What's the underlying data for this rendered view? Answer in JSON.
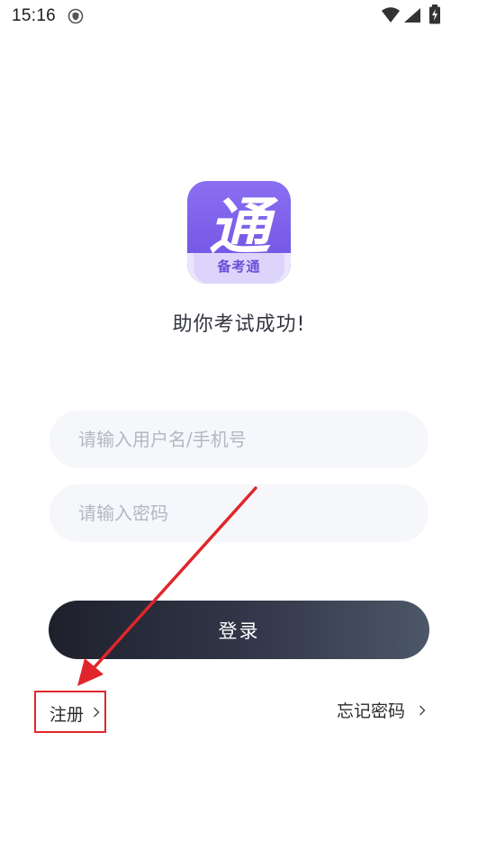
{
  "status_bar": {
    "time": "15:16",
    "icons": [
      "shield-icon",
      "wifi-icon",
      "signal-icon",
      "battery-charging-icon"
    ]
  },
  "logo": {
    "glyph": "通",
    "band_text": "备考通",
    "colors": {
      "primary": "#6d4fe0",
      "band": "#ddd4fb",
      "band_text": "#6b4fd8"
    }
  },
  "tagline": "助你考试成功!",
  "form": {
    "username_placeholder": "请输入用户名/手机号",
    "username_value": "",
    "password_placeholder": "请输入密码",
    "password_value": ""
  },
  "login_button": {
    "label": "登录",
    "gradient": [
      "#1e202c",
      "#4c5768"
    ]
  },
  "links": {
    "register": "注册",
    "forgot_password": "忘记密码"
  },
  "annotation": {
    "color": "#e0262b"
  }
}
